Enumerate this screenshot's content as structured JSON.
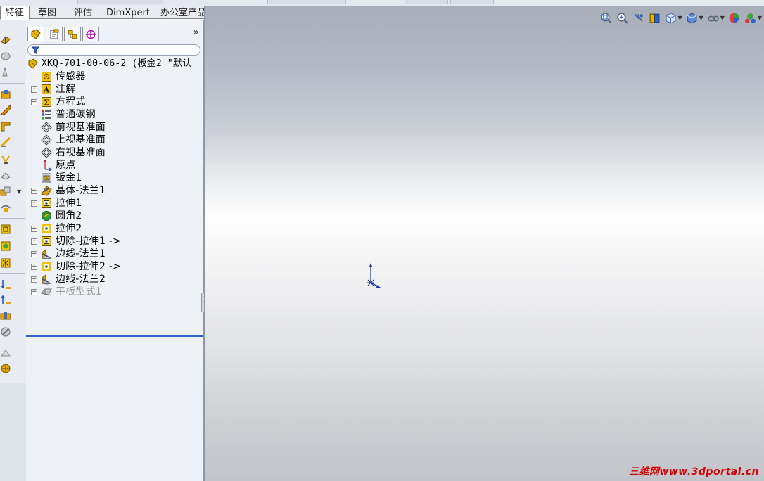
{
  "command_tabs": [
    "特征",
    "草图",
    "评估",
    "DimXpert",
    "办公室产品"
  ],
  "active_command_tab": "特征",
  "feature_manager": {
    "tabs": [
      "featuremanager-tree-icon",
      "propertymanager-icon",
      "configurationmanager-icon",
      "dimxpert-manager-icon"
    ],
    "more_label": "»",
    "root": "XKQ-701-00-06-2  (板金2 \"默认",
    "items": [
      {
        "label": "传感器",
        "icon": "sensor-icon",
        "expandable": false
      },
      {
        "label": "注解",
        "icon": "annotation-icon",
        "expandable": true
      },
      {
        "label": "方程式",
        "icon": "equation-icon",
        "expandable": true
      },
      {
        "label": "普通碳钢",
        "icon": "material-icon",
        "expandable": false
      },
      {
        "label": "前视基准面",
        "icon": "plane-icon",
        "expandable": false
      },
      {
        "label": "上视基准面",
        "icon": "plane-icon",
        "expandable": false
      },
      {
        "label": "右视基准面",
        "icon": "plane-icon",
        "expandable": false
      },
      {
        "label": "原点",
        "icon": "origin-icon",
        "expandable": false
      },
      {
        "label": "钣金1",
        "icon": "sheetmetal-icon",
        "expandable": false
      },
      {
        "label": "基体-法兰1",
        "icon": "base-flange-icon",
        "expandable": true
      },
      {
        "label": "拉伸1",
        "icon": "extrude-icon",
        "expandable": true
      },
      {
        "label": "圆角2",
        "icon": "fillet-icon",
        "expandable": false
      },
      {
        "label": "拉伸2",
        "icon": "extrude-icon",
        "expandable": true
      },
      {
        "label": "切除-拉伸1 ->",
        "icon": "cut-extrude-icon",
        "expandable": true
      },
      {
        "label": "边线-法兰1",
        "icon": "edge-flange-icon",
        "expandable": true
      },
      {
        "label": "切除-拉伸2 ->",
        "icon": "cut-extrude-icon",
        "expandable": true
      },
      {
        "label": "边线-法兰2",
        "icon": "edge-flange-icon",
        "expandable": true
      },
      {
        "label": "平板型式1",
        "icon": "flat-pattern-icon",
        "expandable": true,
        "suppressed": true
      }
    ]
  },
  "view_toolbar": [
    "zoom-to-fit-icon",
    "zoom-to-area-icon",
    "previous-view-icon",
    "section-view-icon",
    "view-orientation-icon",
    "display-style-icon",
    "hide-show-items-icon",
    "edit-appearance-icon",
    "apply-scene-icon"
  ],
  "watermark": "三维网www.3dportal.cn",
  "colors": {
    "accent_line": "#2c63c9",
    "watermark": "#d40000",
    "feature_yellow": "#f2c200"
  }
}
